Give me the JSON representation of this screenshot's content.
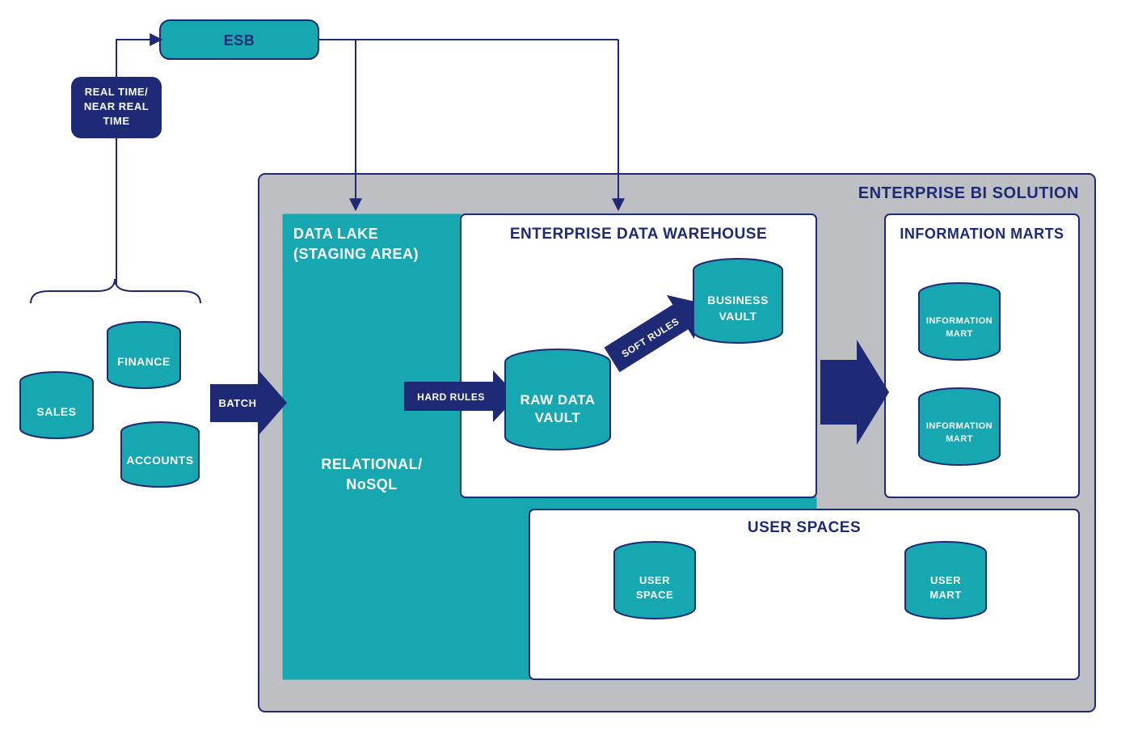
{
  "colors": {
    "teal": "#16A7B0",
    "tealDark": "#0B8F98",
    "navy": "#1E2A75",
    "grey": "#BEBFC2",
    "white": "#FFFFFF"
  },
  "esb": {
    "label": "ESB"
  },
  "realtime": {
    "line1": "REAL TIME/",
    "line2": "NEAR REAL",
    "line3": "TIME"
  },
  "sources": {
    "sales": {
      "label": "SALES"
    },
    "finance": {
      "label": "FINANCE"
    },
    "accounts": {
      "label": "ACCOUNTS"
    }
  },
  "batch": {
    "label": "BATCH"
  },
  "solution": {
    "title": "ENTERPRISE BI SOLUTION"
  },
  "datalake": {
    "title1": "DATA LAKE",
    "title2": "(STAGING AREA)",
    "sub1": "RELATIONAL/",
    "sub2": "NoSQL"
  },
  "edw": {
    "title": "ENTERPRISE DATA WAREHOUSE",
    "hardRules": "HARD RULES",
    "softRules": "SOFT RULES",
    "rawVault1": "RAW DATA",
    "rawVault2": "VAULT",
    "bizVault1": "BUSINESS",
    "bizVault2": "VAULT"
  },
  "marts": {
    "title": "INFORMATION MARTS",
    "mart1a": "INFORMATION",
    "mart1b": "MART",
    "mart2a": "INFORMATION",
    "mart2b": "MART"
  },
  "userSpaces": {
    "title": "USER SPACES",
    "space1a": "USER",
    "space1b": "SPACE",
    "mart1a": "USER",
    "mart1b": "MART"
  }
}
